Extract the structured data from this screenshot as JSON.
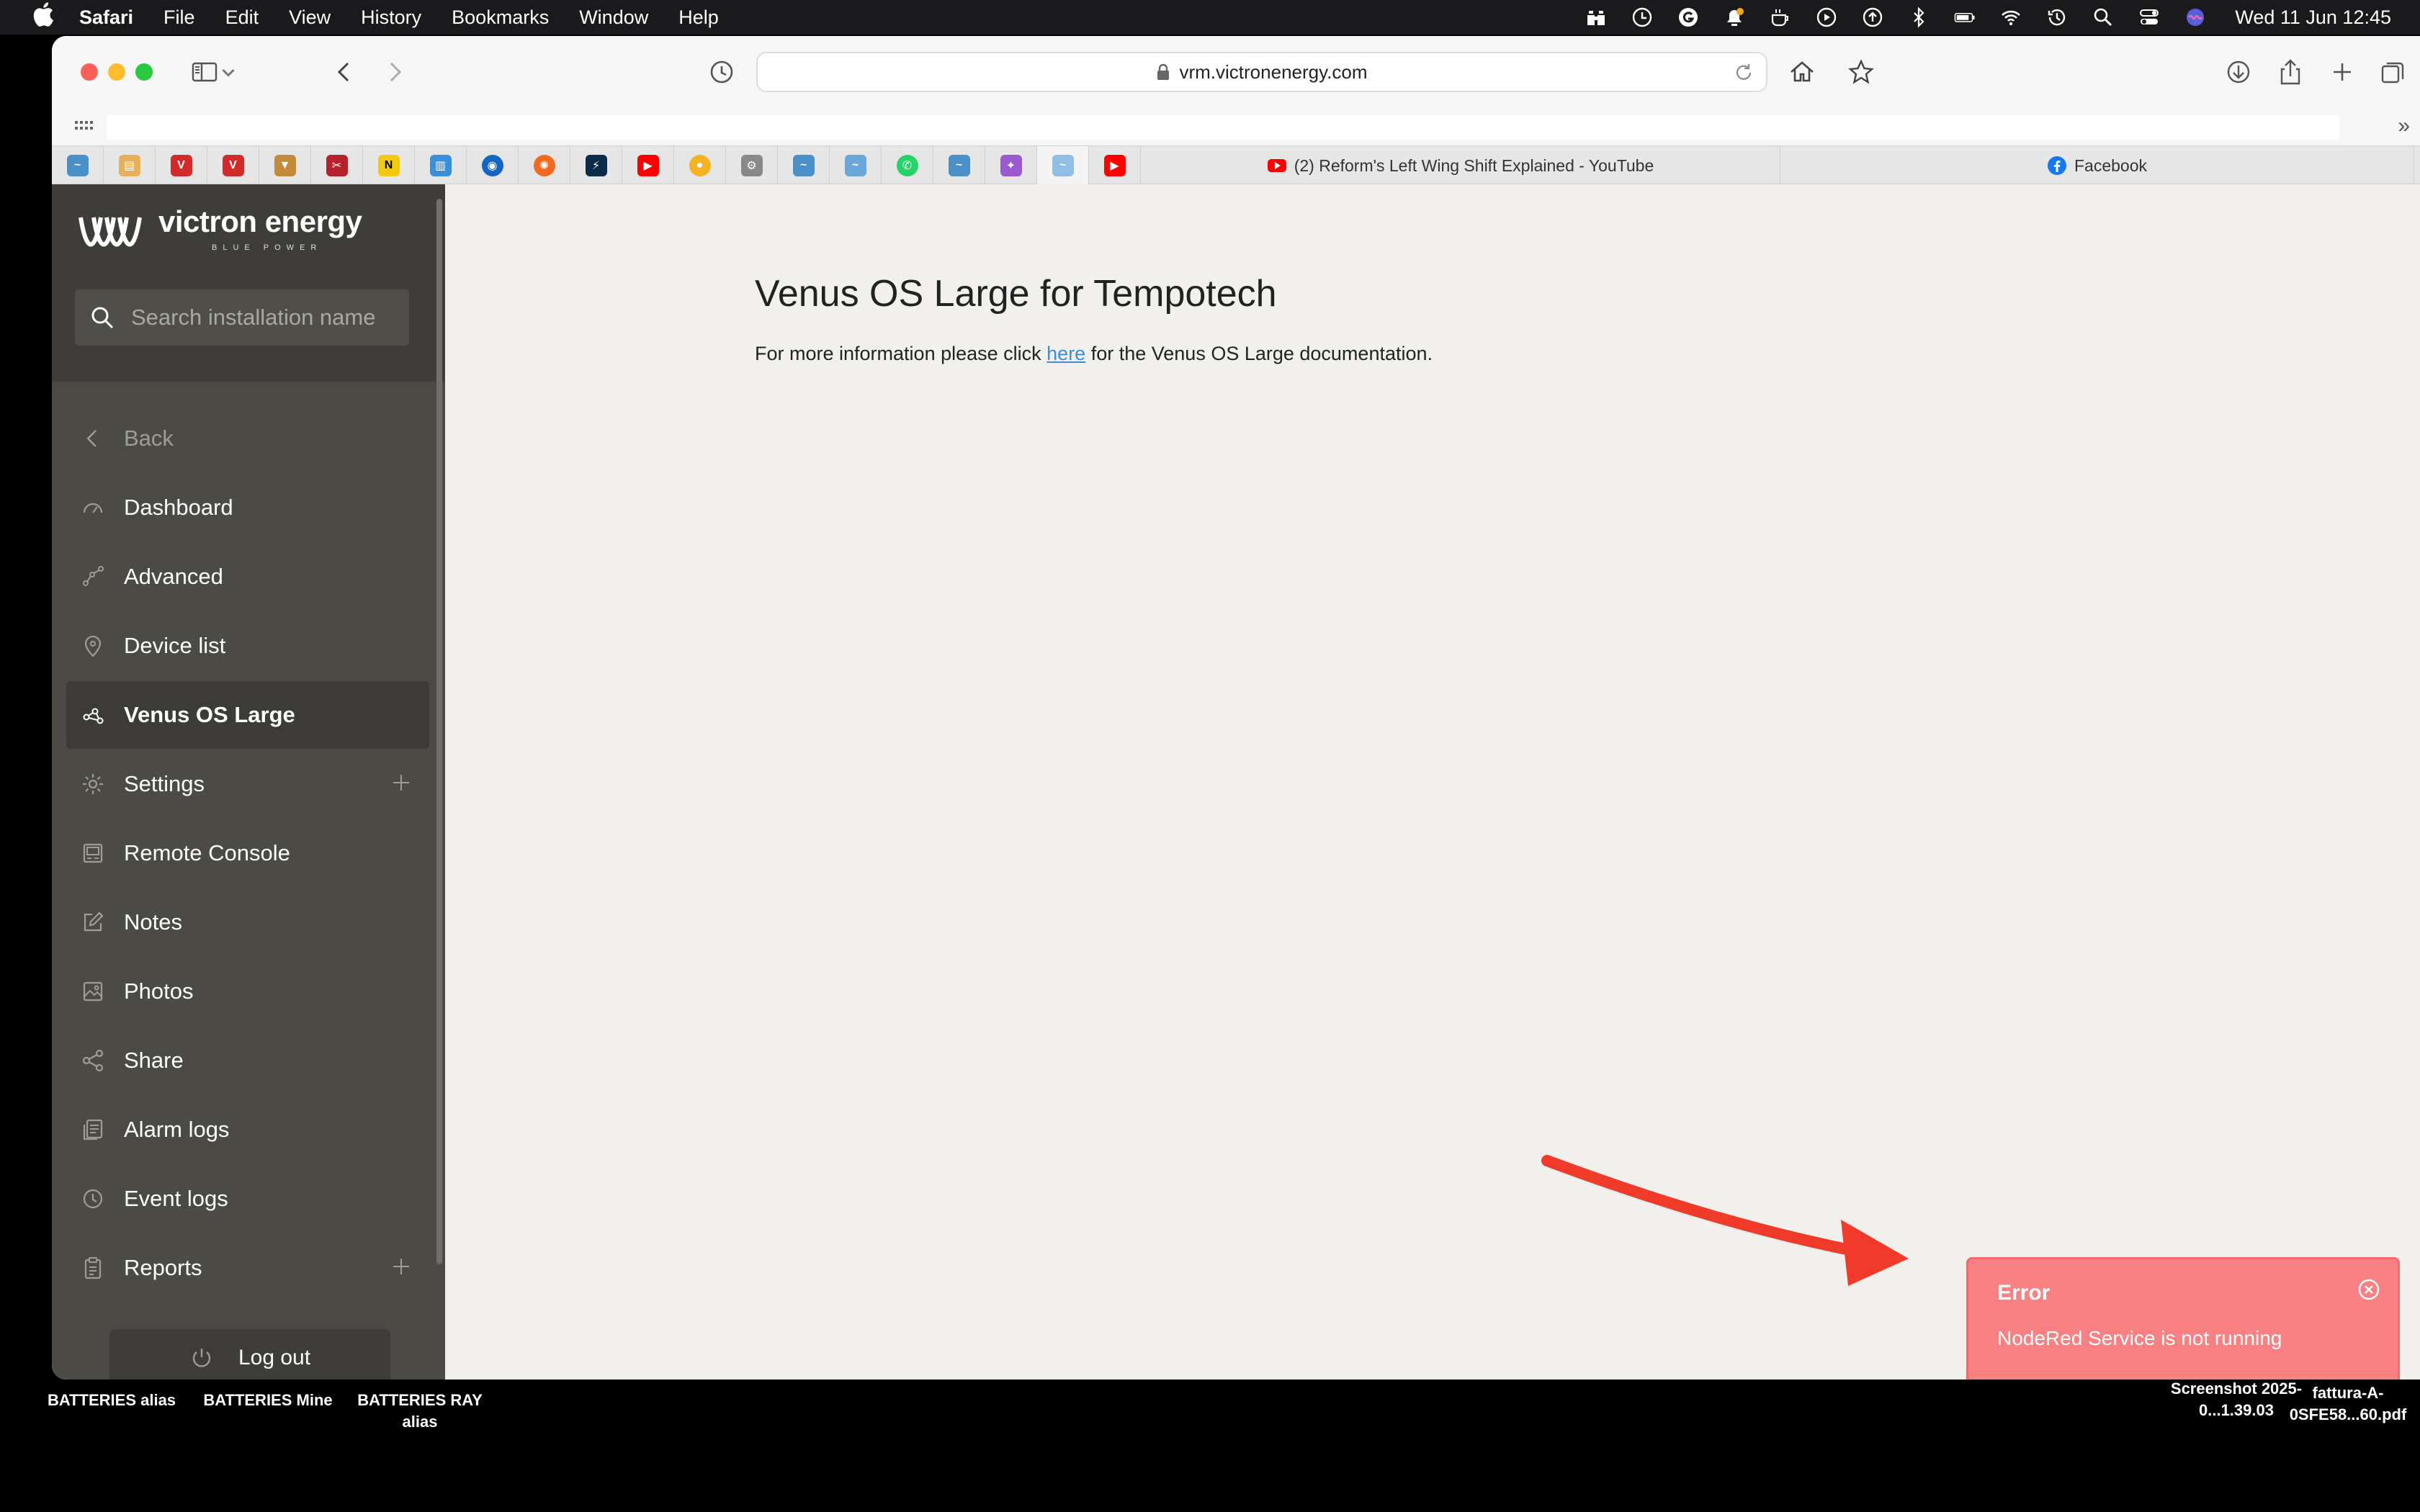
{
  "menubar": {
    "app": "Safari",
    "items": [
      "File",
      "Edit",
      "View",
      "History",
      "Bookmarks",
      "Window",
      "Help"
    ],
    "clock": "Wed 11 Jun  12:45"
  },
  "browser": {
    "url": "vrm.victronenergy.com",
    "tabs": [
      {
        "title": "(2) Reform's Left Wing Shift Explained - YouTube"
      },
      {
        "title": "Facebook"
      }
    ]
  },
  "sidebar": {
    "brand": "victron energy",
    "brand_sub": "BLUE POWER",
    "search_placeholder": "Search installation name",
    "back": "Back",
    "items": [
      {
        "label": "Dashboard"
      },
      {
        "label": "Advanced"
      },
      {
        "label": "Device list"
      },
      {
        "label": "Venus OS Large"
      },
      {
        "label": "Settings"
      },
      {
        "label": "Remote Console"
      },
      {
        "label": "Notes"
      },
      {
        "label": "Photos"
      },
      {
        "label": "Share"
      },
      {
        "label": "Alarm logs"
      },
      {
        "label": "Event logs"
      },
      {
        "label": "Reports"
      }
    ],
    "logout": "Log out"
  },
  "main": {
    "title": "Venus OS Large for Tempotech",
    "text_before": "For more information please click ",
    "link": "here",
    "text_after": " for the Venus OS Large documentation."
  },
  "toast": {
    "title": "Error",
    "message": "NodeRed Service is not running"
  },
  "desktop": {
    "labels": [
      "BATTERIES alias",
      "BATTERIES Mine",
      "BATTERIES RAY alias"
    ],
    "files": [
      "Screenshot 2025-0...1.39.03",
      "fattura-A-0SFE58...60.pdf"
    ]
  },
  "colors": {
    "sidebar": "#4b4a45",
    "page_bg": "#f1f0ed",
    "toast": "#f98184",
    "link": "#3d8ed6",
    "arrow": "#f03a2a"
  }
}
